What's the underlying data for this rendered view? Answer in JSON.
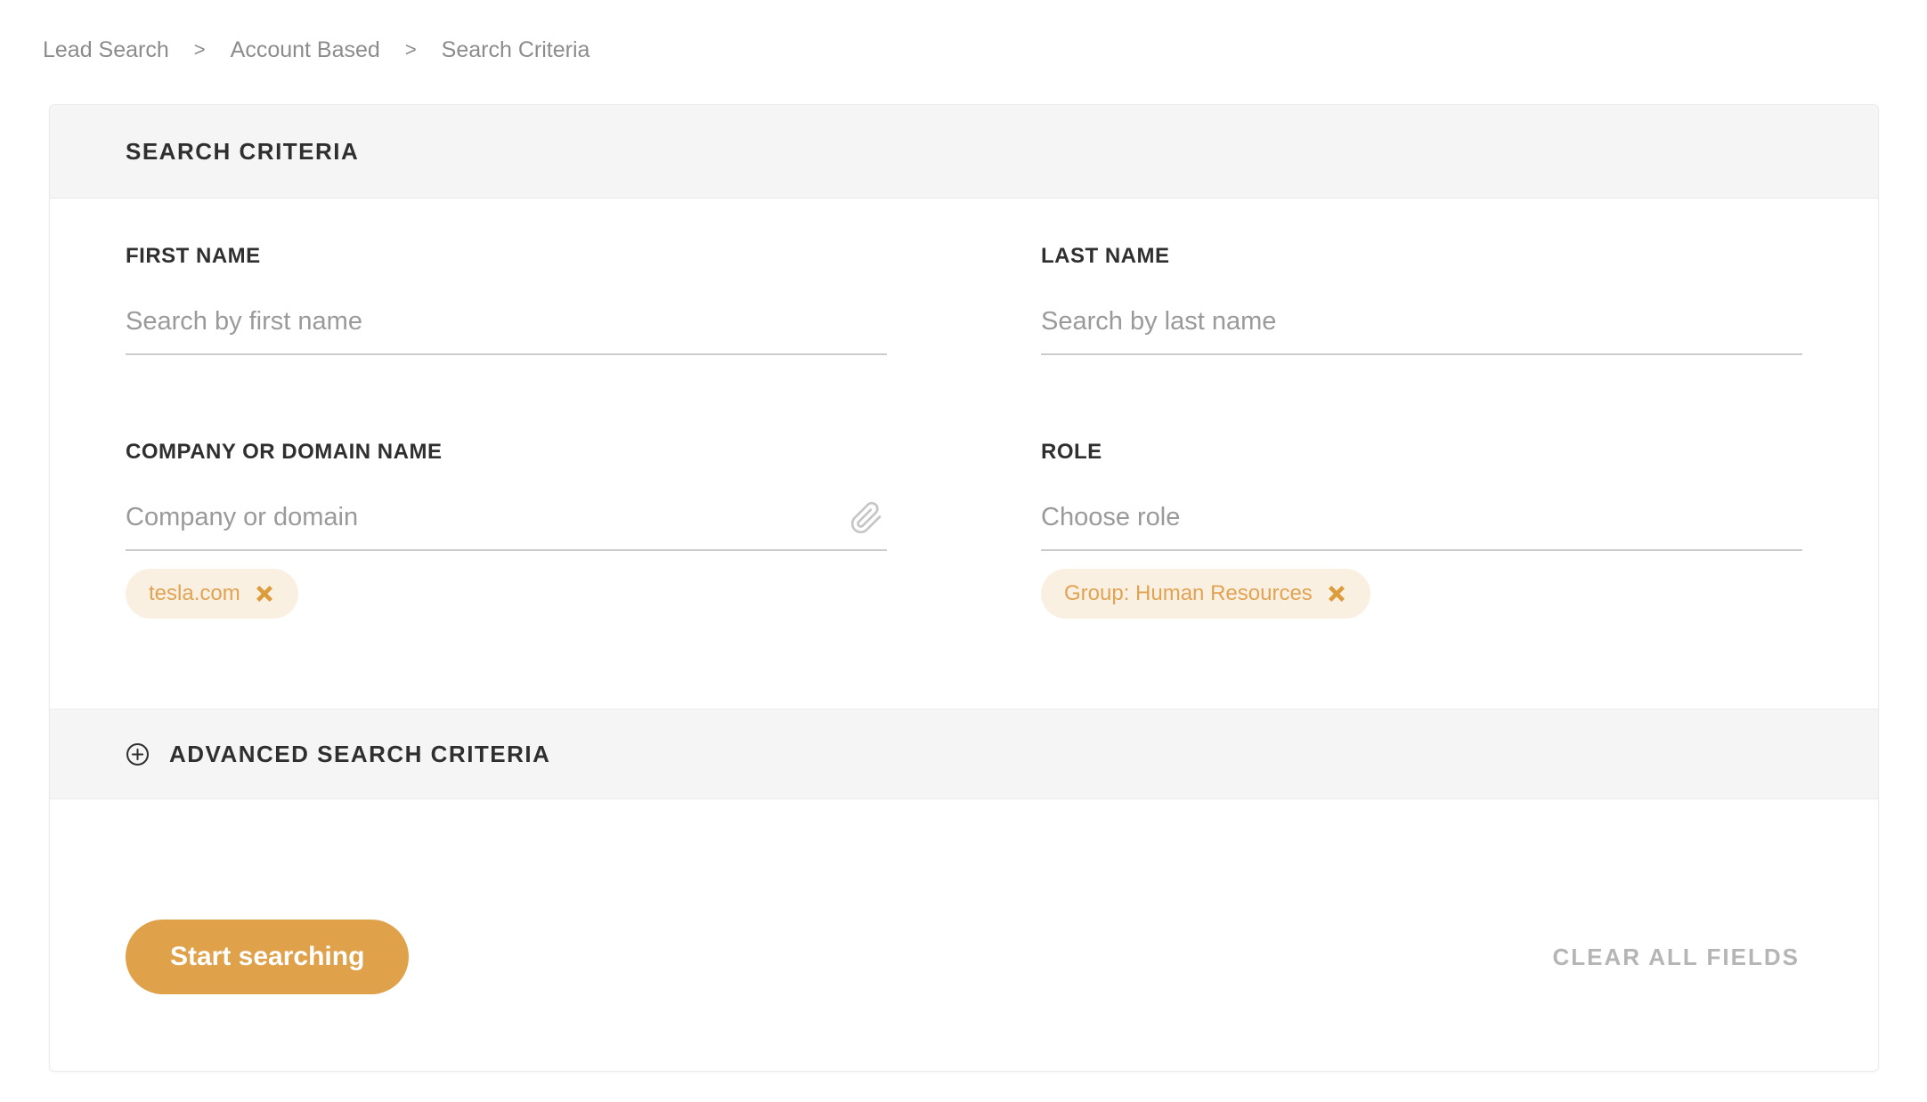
{
  "breadcrumb": {
    "separator": ">",
    "items": [
      {
        "label": "Lead Search"
      },
      {
        "label": "Account Based"
      },
      {
        "label": "Search Criteria"
      }
    ]
  },
  "panel": {
    "title": "SEARCH CRITERIA",
    "fields": {
      "first_name": {
        "label": "FIRST NAME",
        "placeholder": "Search by first name",
        "value": ""
      },
      "last_name": {
        "label": "LAST NAME",
        "placeholder": "Search by last name",
        "value": ""
      },
      "company": {
        "label": "COMPANY OR DOMAIN NAME",
        "placeholder": "Company or domain",
        "value": "",
        "attach_icon": "paperclip-icon",
        "tags": [
          {
            "label": "tesla.com",
            "remove_icon": "close-icon"
          }
        ]
      },
      "role": {
        "label": "ROLE",
        "placeholder": "Choose role",
        "value": "",
        "tags": [
          {
            "label": "Group: Human Resources",
            "remove_icon": "close-icon"
          }
        ]
      }
    },
    "advanced": {
      "label": "ADVANCED SEARCH CRITERIA",
      "icon": "plus-circle-icon"
    },
    "footer": {
      "start_button_label": "Start searching",
      "clear_all_label": "CLEAR ALL FIELDS"
    }
  },
  "colors": {
    "accent_orange": "#e0a14b",
    "tag_background": "#faf0e2",
    "tag_text": "#e0a353",
    "tag_close_icon": "#dd9b3c",
    "section_gray": "#f5f5f5",
    "underline_gray": "#cccccc",
    "placeholder_gray": "#9a9a9a",
    "label_dark": "#2f2f2f",
    "breadcrumb_gray": "#8c8c8c",
    "clear_all_gray": "#b5b5b5"
  }
}
